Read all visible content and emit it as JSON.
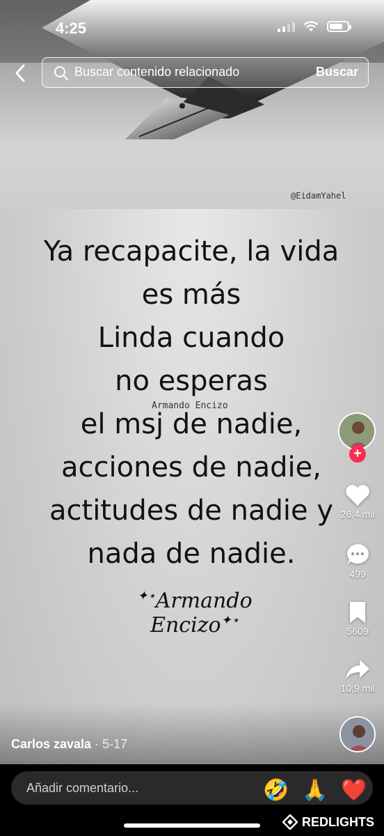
{
  "status_bar": {
    "time": "4:25",
    "battery_level": 0.75
  },
  "search": {
    "placeholder": "Buscar contenido relacionado",
    "button_label": "Buscar"
  },
  "video": {
    "watermark": "@EidamYahel",
    "overlay_name": "Armando Encizo",
    "quote_lines": [
      "Ya recapacite, la vida",
      "es más",
      "Linda cuando",
      "no esperas",
      "el msj de nadie,",
      "acciones de nadie,",
      "actitudes de nadie y",
      "nada de nadie."
    ],
    "signature": "Armando Encizo"
  },
  "actions": {
    "likes": "26,4 mil",
    "comments": "499",
    "saves": "5609",
    "shares": "10,9 mil"
  },
  "author": {
    "name": "Carlos zavala",
    "date": "· 5-17"
  },
  "comment_bar": {
    "placeholder": "Añadir comentario...",
    "emojis": [
      "🤣",
      "🙏",
      "❤️"
    ]
  },
  "brand": "REDLIGHTS",
  "colors": {
    "follow_plus": "#fe2c55",
    "overlay_text": "#111111"
  }
}
